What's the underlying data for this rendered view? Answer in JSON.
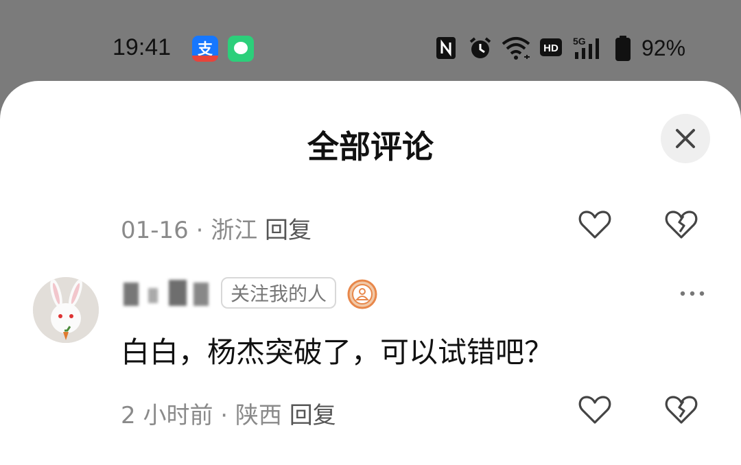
{
  "status_bar": {
    "time": "19:41",
    "battery_percent": "92%",
    "apps": [
      "alipay-icon",
      "messages-icon"
    ],
    "indicators": [
      "nfc-icon",
      "alarm-icon",
      "wifi-icon",
      "hd-icon",
      "signal-5g-icon",
      "battery-icon"
    ],
    "signal_label": "5G",
    "hd_label": "HD"
  },
  "sheet": {
    "title": "全部评论"
  },
  "comments": [
    {
      "meta": "01-16 · 浙江",
      "reply_label": "回复"
    },
    {
      "tag": "关注我的人",
      "text": "白白，杨杰突破了，可以试错吧？",
      "meta": "2 小时前 · 陕西",
      "reply_label": "回复"
    }
  ],
  "colors": {
    "overlay": "#7b7b7b",
    "sheet_bg": "#ffffff",
    "meta_text": "#8a8a8a",
    "badge": "#e8874a"
  }
}
